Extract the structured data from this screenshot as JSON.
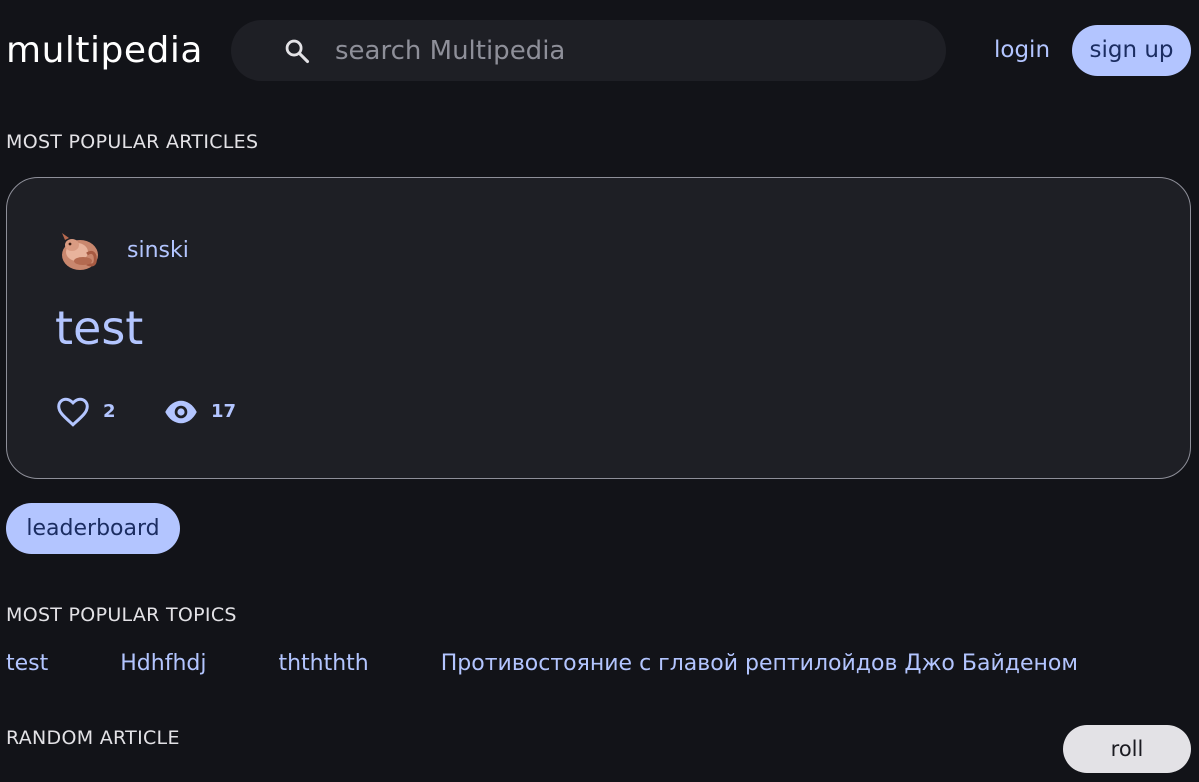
{
  "header": {
    "logo": "multipedia",
    "search": {
      "placeholder": "search Multipedia",
      "value": "",
      "icon": "search-icon"
    },
    "login_label": "login",
    "signup_label": "sign up"
  },
  "popular_articles": {
    "heading": "MOST POPULAR ARTICLES",
    "items": [
      {
        "author": "sinski",
        "title": "test",
        "likes": "2",
        "views": "17"
      }
    ]
  },
  "leaderboard_label": "leaderboard",
  "popular_topics": {
    "heading": "MOST POPULAR TOPICS",
    "items": [
      "test",
      "Hdhfhdj",
      "thththth",
      "Противостояние с главой рептилойдов Джо Байденом"
    ]
  },
  "random_article": {
    "heading": "RANDOM ARTICLE",
    "roll_label": "roll"
  },
  "colors": {
    "background": "#121318",
    "surface": "#1e1f25",
    "accent": "#b3c5ff",
    "on_accent": "#1b2d61",
    "outline": "#8e8f99"
  }
}
